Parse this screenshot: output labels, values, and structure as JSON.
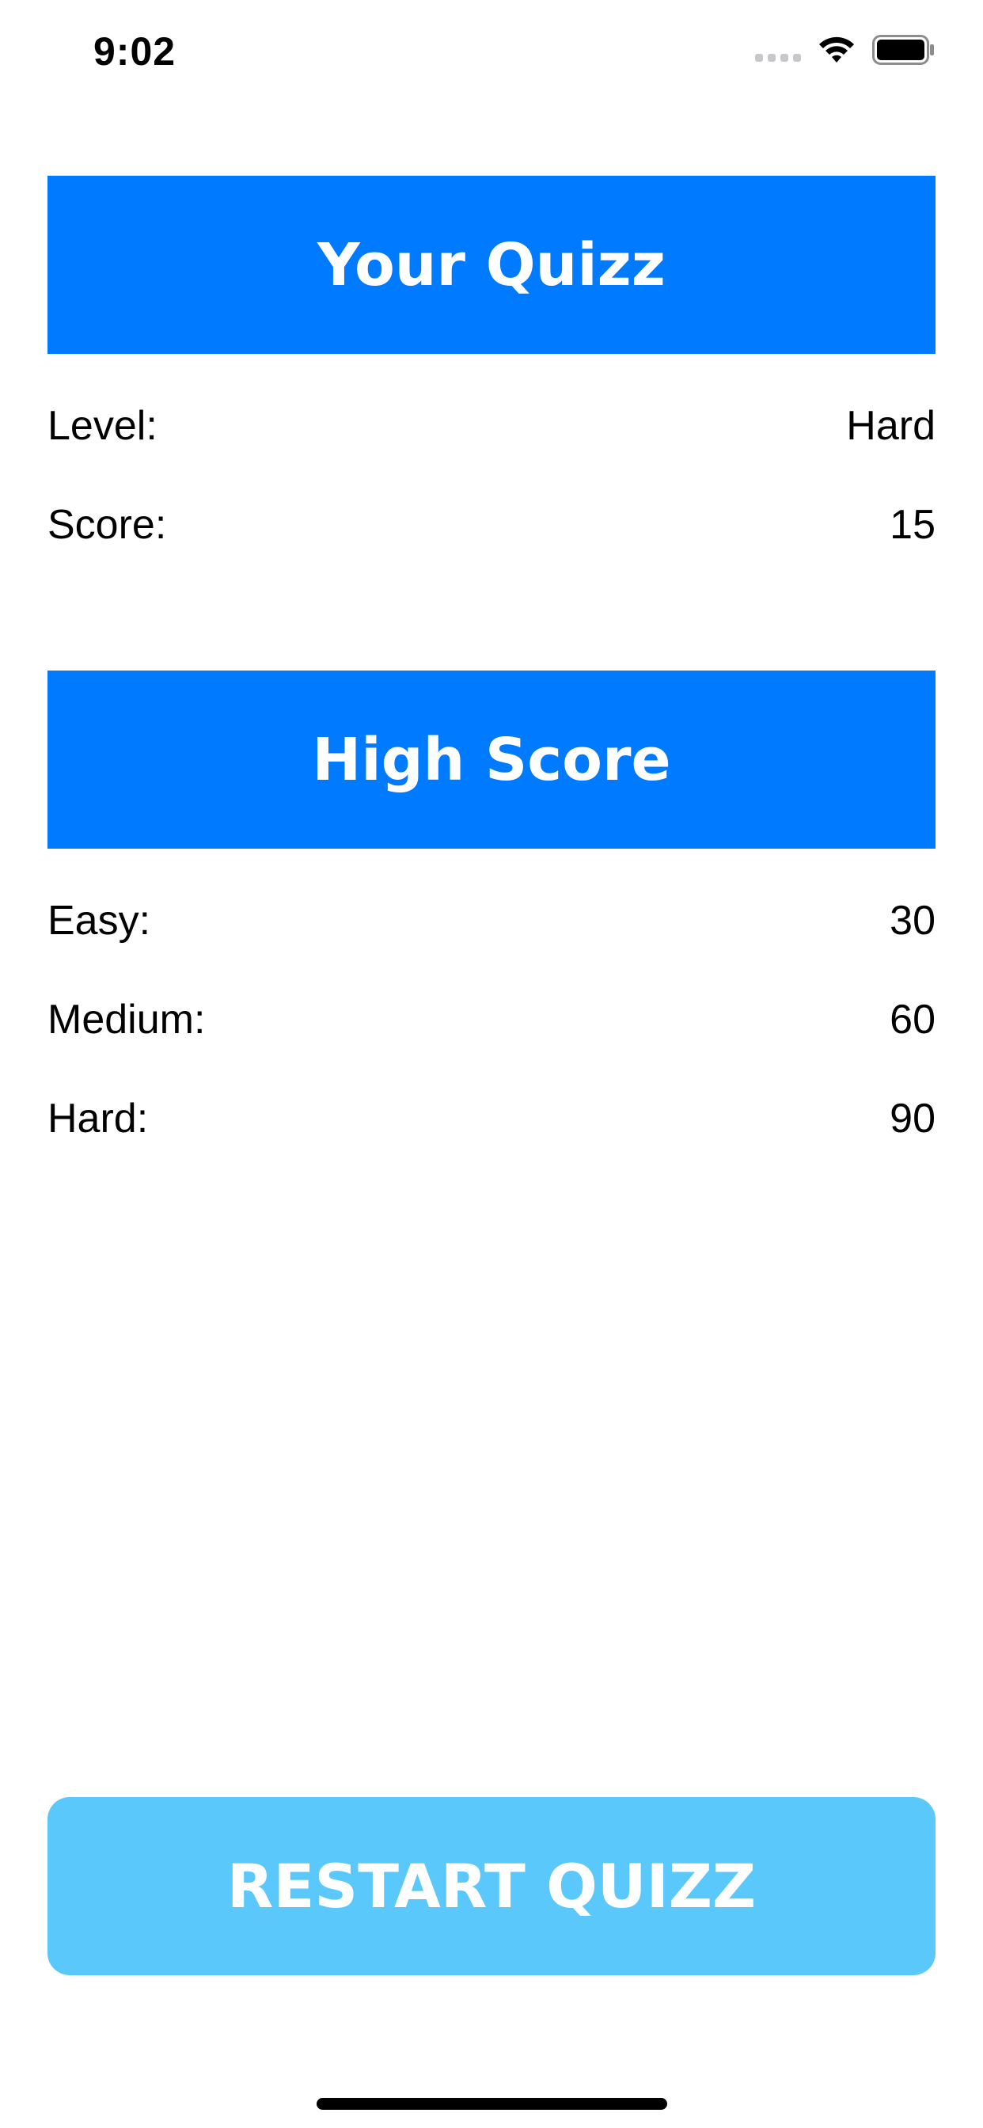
{
  "status_bar": {
    "time": "9:02",
    "icons": [
      "signal-icon",
      "wifi-icon",
      "battery-icon"
    ]
  },
  "your_quiz": {
    "title": "Your Quizz",
    "rows": [
      {
        "label": "Level:",
        "value": "Hard"
      },
      {
        "label": "Score:",
        "value": "15"
      }
    ]
  },
  "high_score": {
    "title": "High Score",
    "rows": [
      {
        "label": "Easy:",
        "value": "30"
      },
      {
        "label": "Medium:",
        "value": "60"
      },
      {
        "label": "Hard:",
        "value": "90"
      }
    ]
  },
  "restart_button": {
    "label": "RESTART QUIZZ"
  },
  "colors": {
    "header_blue": "#007aff",
    "button_light_blue": "#5ac8fa",
    "text": "#000000",
    "header_text": "#ffffff"
  }
}
